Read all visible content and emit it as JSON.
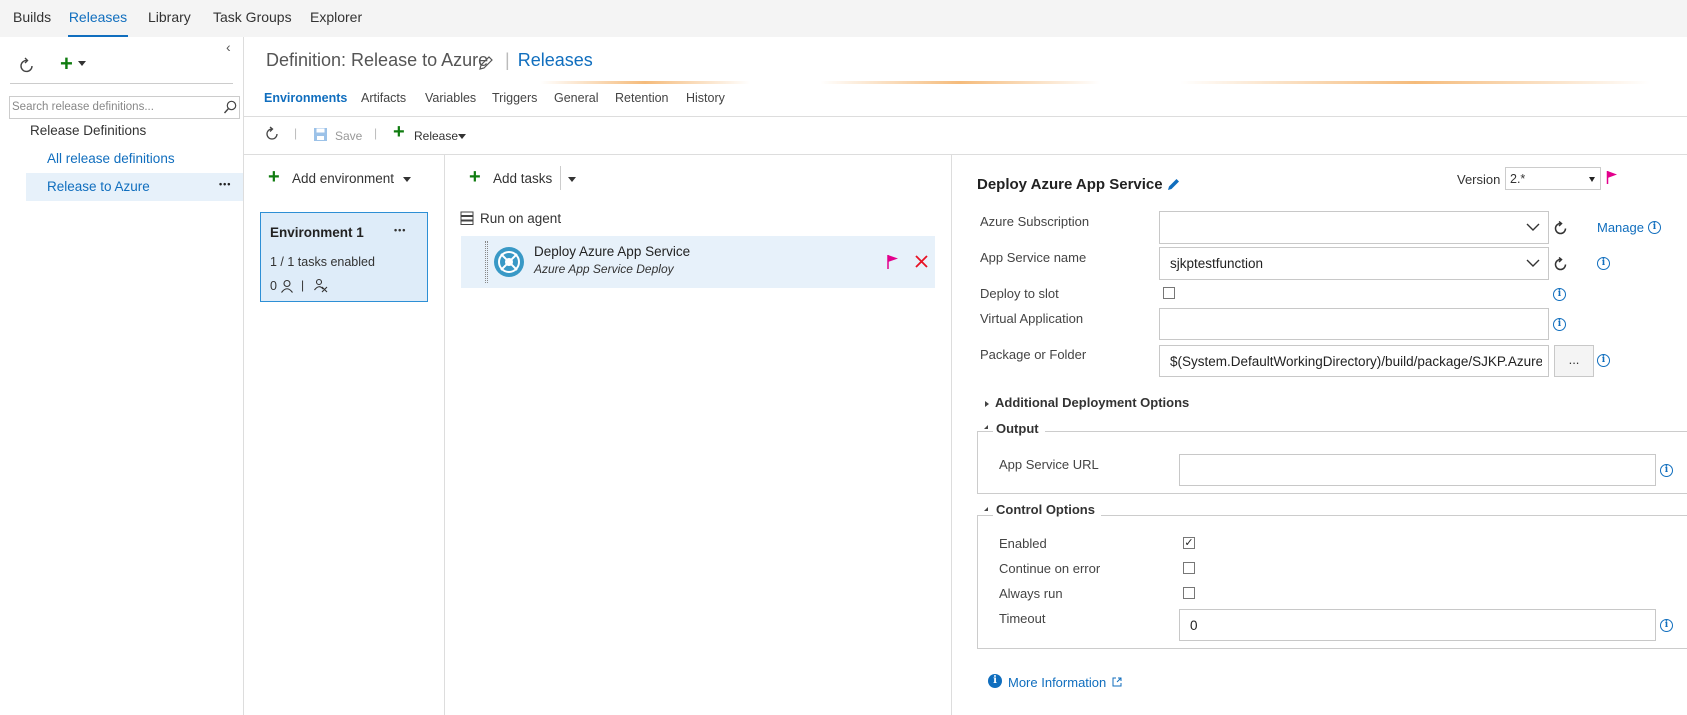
{
  "topnav": {
    "tabs": [
      "Builds",
      "Releases",
      "Library",
      "Task Groups",
      "Explorer"
    ]
  },
  "sidebar": {
    "search_placeholder": "Search release definitions...",
    "tree_root": "Release Definitions",
    "items": [
      "All release definitions",
      "Release to Azure"
    ],
    "more": "•••"
  },
  "header": {
    "prefix": "Definition: Release to Azure",
    "separator": "|",
    "link": "Releases"
  },
  "subtabs": [
    "Environments",
    "Artifacts",
    "Variables",
    "Triggers",
    "General",
    "Retention",
    "History"
  ],
  "toolbar": {
    "save": "Save",
    "release": "Release"
  },
  "environments": {
    "add_label": "Add environment",
    "card": {
      "title": "Environment 1",
      "more": "•••",
      "tasks": "1 / 1 tasks enabled",
      "approvers": "0",
      "sep": "|"
    }
  },
  "tasks": {
    "add_label": "Add tasks",
    "phase": "Run on agent",
    "item": {
      "title": "Deploy Azure App Service",
      "subtitle": "Azure App Service Deploy"
    }
  },
  "details": {
    "title": "Deploy Azure App Service",
    "version_label": "Version",
    "version_value": "2.*",
    "azure_subscription": {
      "label": "Azure Subscription",
      "value": "",
      "manage": "Manage"
    },
    "app_service_name": {
      "label": "App Service name",
      "value": "sjkptestfunction"
    },
    "deploy_to_slot": {
      "label": "Deploy to slot"
    },
    "virtual_application": {
      "label": "Virtual Application",
      "value": ""
    },
    "package_or_folder": {
      "label": "Package or Folder",
      "value": "$(System.DefaultWorkingDirectory)/build/package/SJKP.Azure",
      "browse": "..."
    },
    "additional_options": "Additional Deployment Options",
    "output": {
      "title": "Output",
      "app_service_url_label": "App Service URL",
      "app_service_url_value": ""
    },
    "control_options": {
      "title": "Control Options",
      "enabled": "Enabled",
      "continue_on_error": "Continue on error",
      "always_run": "Always run",
      "timeout_label": "Timeout",
      "timeout_value": "0"
    },
    "more_info": "More Information"
  },
  "colors": {
    "accent": "#106ebe",
    "add_green": "#107c10",
    "flag_pink": "#e3008c",
    "delete_red": "#e81123",
    "selected_bg": "#e7f1fa"
  }
}
